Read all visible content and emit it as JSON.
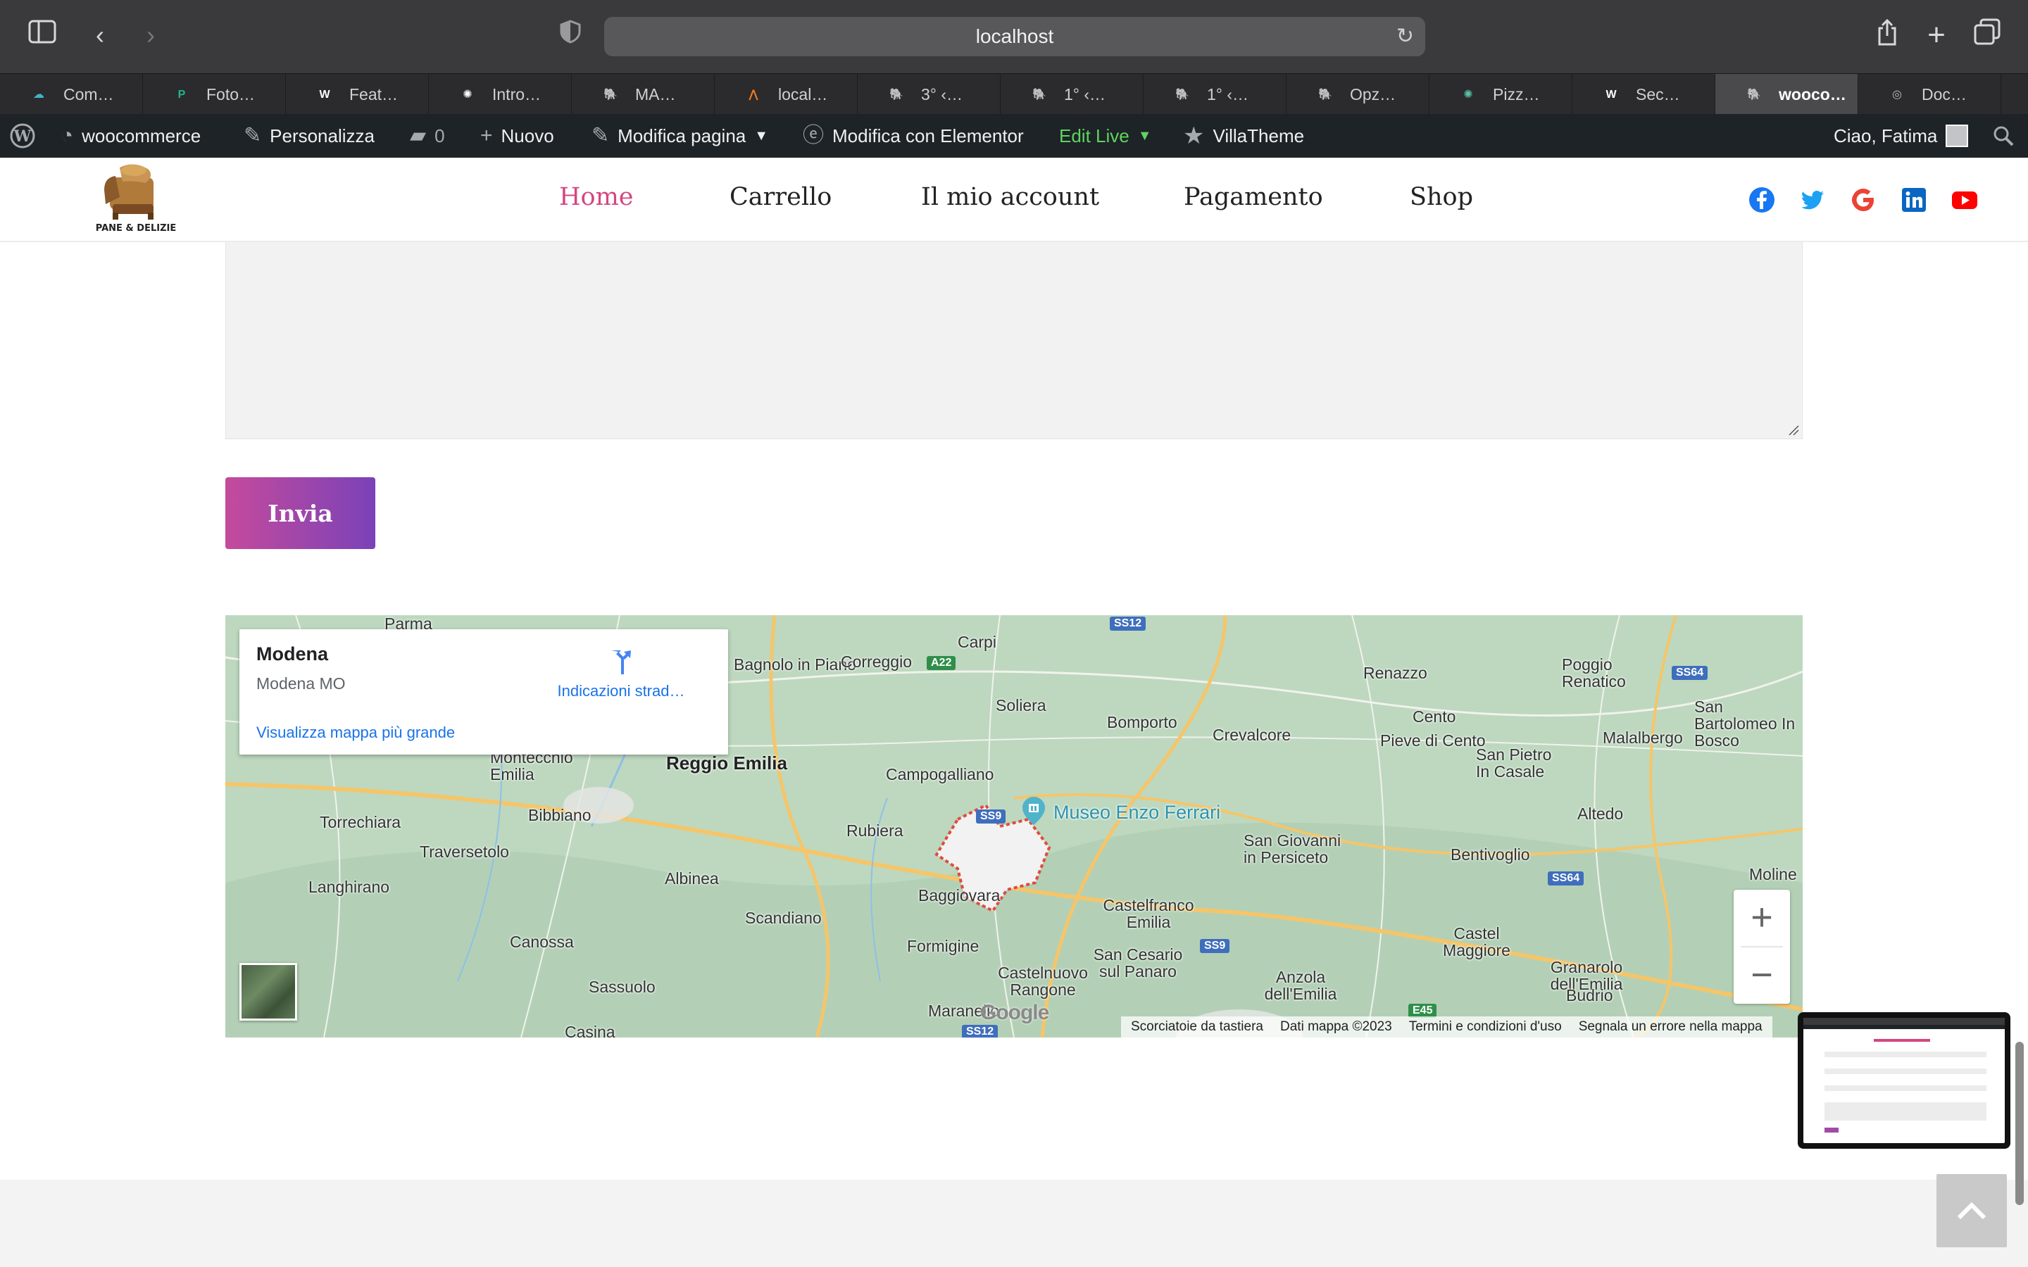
{
  "browser": {
    "url": "localhost",
    "tabs": [
      {
        "label": "Com…",
        "icon": "cloud-icon",
        "color": "#3fb6c6"
      },
      {
        "label": "Foto…",
        "icon": "p-logo-icon",
        "color": "#1fb58a"
      },
      {
        "label": "Feat…",
        "icon": "wordpress-icon",
        "color": "#ffffff"
      },
      {
        "label": "Intro…",
        "icon": "openai-icon",
        "color": "#ffffff"
      },
      {
        "label": "MA…",
        "icon": "elephant-icon",
        "color": "#ffffff"
      },
      {
        "label": "local…",
        "icon": "xampp-icon",
        "color": "#f07b1f"
      },
      {
        "label": "3° ‹…",
        "icon": "elephant-icon",
        "color": "#ffffff"
      },
      {
        "label": "1° ‹…",
        "icon": "elephant-icon",
        "color": "#ffffff"
      },
      {
        "label": "1° ‹…",
        "icon": "elephant-icon",
        "color": "#ffffff"
      },
      {
        "label": "Opz…",
        "icon": "elephant-icon",
        "color": "#ffffff"
      },
      {
        "label": "Pizz…",
        "icon": "openai-icon",
        "color": "#58c2a6"
      },
      {
        "label": "Sec…",
        "icon": "wordpress-icon",
        "color": "#ffffff"
      },
      {
        "label": "wooco…",
        "icon": "elephant-icon",
        "color": "#ffffff",
        "active": true
      },
      {
        "label": "Doc…",
        "icon": "compass-icon",
        "color": "#bbbbbb"
      }
    ]
  },
  "adminbar": {
    "site": "woocommerce",
    "customize": "Personalizza",
    "comments_count": "0",
    "new": "Nuovo",
    "edit_page": "Modifica pagina",
    "elementor": "Modifica con Elementor",
    "edit_live": "Edit Live",
    "villatheme": "VillaTheme",
    "greeting": "Ciao, Fatima"
  },
  "header": {
    "logo_text": "PANE & DELIZIE",
    "nav": [
      "Home",
      "Carrello",
      "Il mio account",
      "Pagamento",
      "Shop"
    ],
    "active_nav": "Home",
    "social": [
      "facebook-icon",
      "twitter-icon",
      "google-icon",
      "linkedin-icon",
      "youtube-icon"
    ],
    "accent": "#d4467f"
  },
  "form": {
    "submit_label": "Invia"
  },
  "map": {
    "card_title": "Modena",
    "card_subtitle": "Modena MO",
    "directions": "Indicazioni strad…",
    "larger_map": "Visualizza mappa più grande",
    "landmark": "Museo Enzo Ferrari",
    "places": [
      "Parma",
      "Carpi",
      "Bagnolo in Piano",
      "Correggio",
      "Soliera",
      "Bomporto",
      "Crevalcore",
      "Renazzo",
      "Cento",
      "Pieve di Cento",
      "Poggio Renatico",
      "San Bartolomeo In Bosco",
      "Malalbergo",
      "San Pietro In Casale",
      "Montecchio Emilia",
      "Reggio Emilia",
      "Campogalliano",
      "Torrechiara",
      "Bibbiano",
      "Rubiera",
      "Traversetolo",
      "San Giovanni in Persiceto",
      "Altedo",
      "Langhirano",
      "Albinea",
      "Baggiovara",
      "Bentivoglio",
      "Moline",
      "Scandiano",
      "Castelfranco Emilia",
      "Canossa",
      "Formigine",
      "San Cesario sul Panaro",
      "Castel Maggiore",
      "Castelnuovo Rangone",
      "Anzola dell'Emilia",
      "Granarolo dell'Emilia",
      "Sassuolo",
      "Budrio",
      "Maranello",
      "Casina"
    ],
    "roads": [
      "SS12",
      "A22",
      "SS64",
      "SS9",
      "SS9",
      "SS64",
      "E45",
      "SS12"
    ],
    "zoom_in": "+",
    "zoom_out": "−",
    "attribution": [
      "Scorciatoie da tastiera",
      "Dati mappa ©2023",
      "Termini e condizioni d'uso",
      "Segnala un errore nella mappa"
    ],
    "google": "Google"
  }
}
